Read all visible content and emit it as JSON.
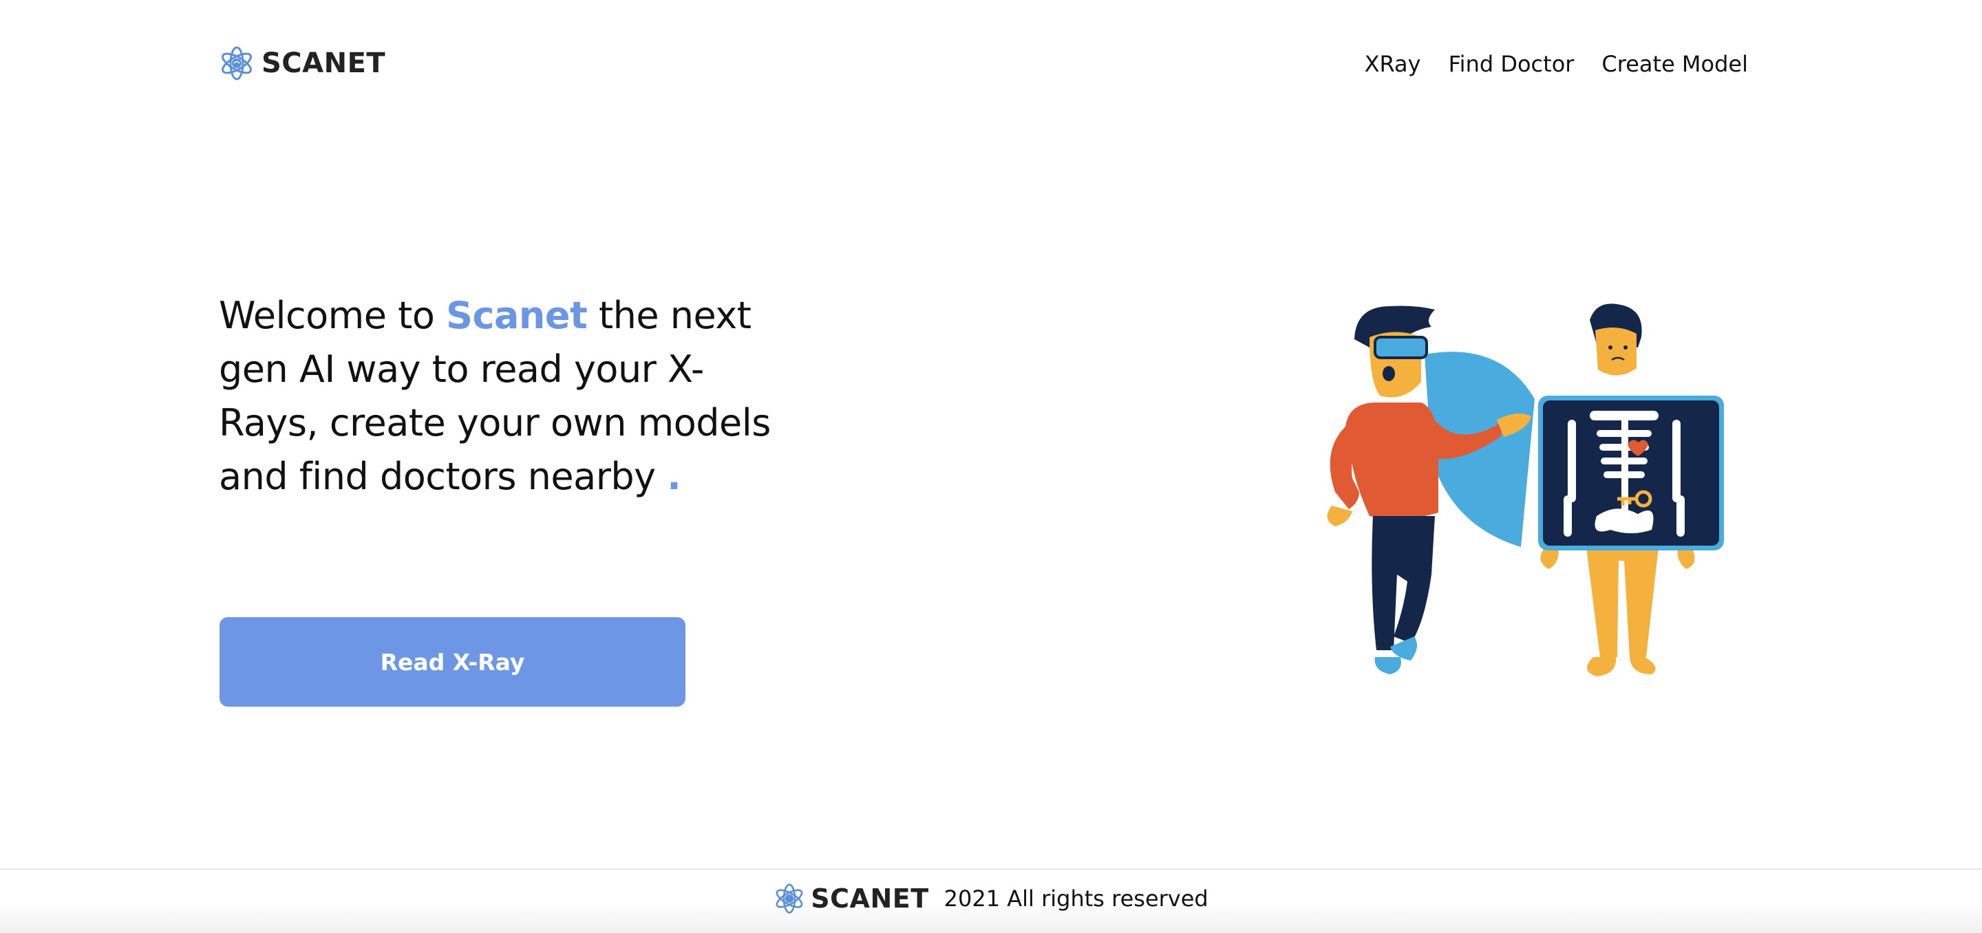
{
  "brand": {
    "name": "SCANET",
    "accent_color": "#6a96e4",
    "icon": "atom-brain-icon"
  },
  "nav": {
    "items": [
      {
        "label": "XRay"
      },
      {
        "label": "Find Doctor"
      },
      {
        "label": "Create Model"
      }
    ]
  },
  "hero": {
    "prefix": "Welcome to ",
    "highlight": "Scanet",
    "suffix": " the next gen AI way to read your X-Rays, create your own models and find doctors nearby ",
    "dot": ".",
    "cta_label": "Read X-Ray",
    "cta_color": "#6d97e4",
    "illustration": "doctor-xray-illustration"
  },
  "footer": {
    "brand_name": "SCANET",
    "copyright": "2021 All rights reserved"
  }
}
